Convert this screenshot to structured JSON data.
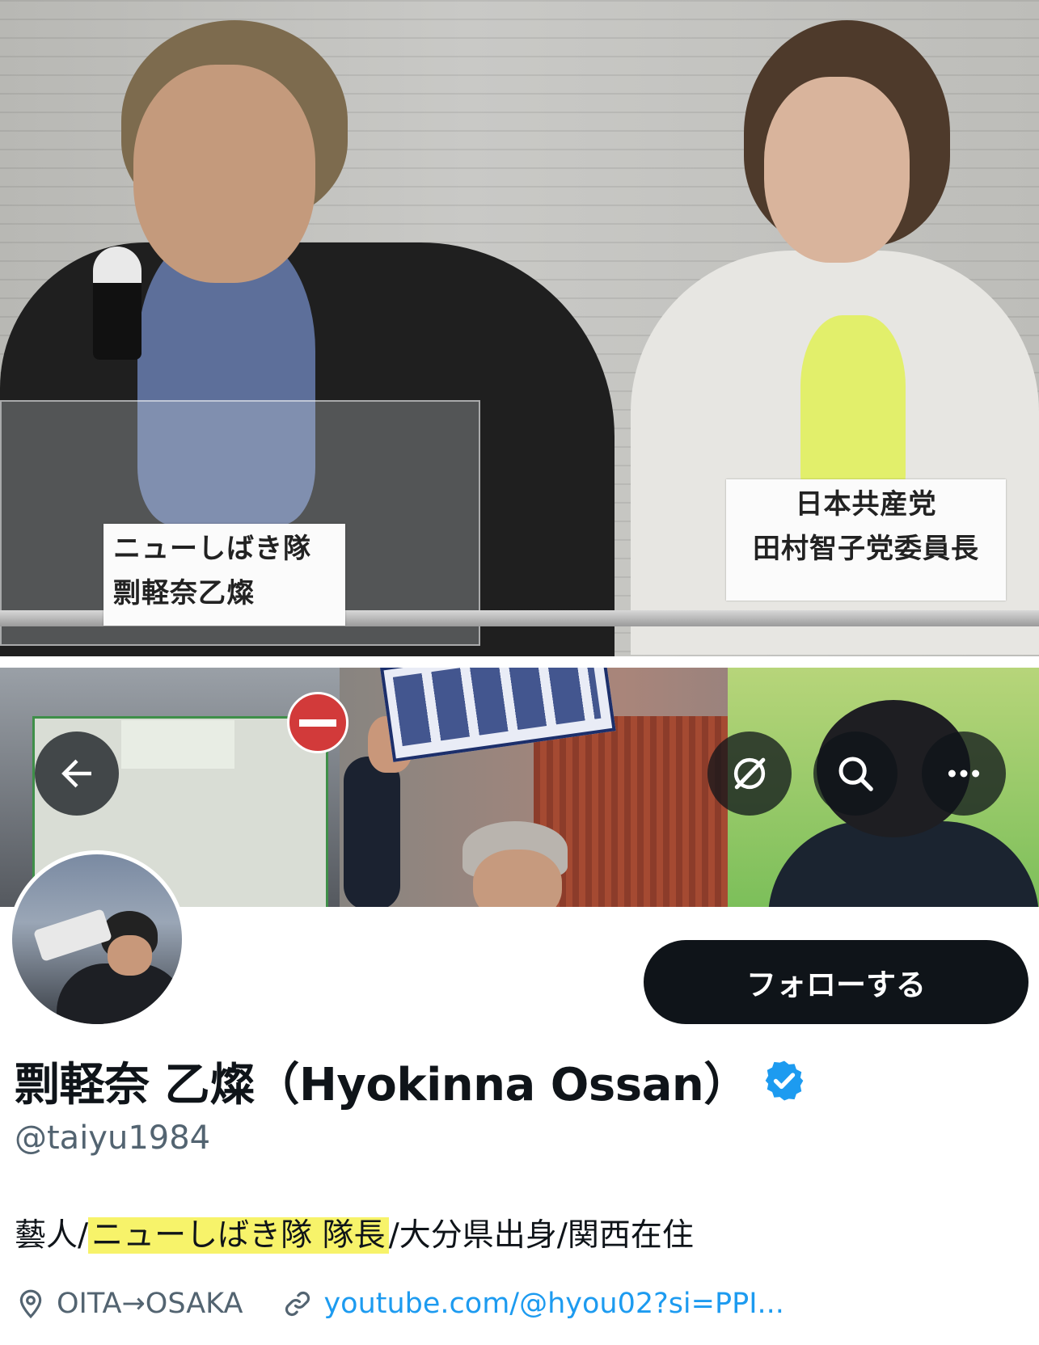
{
  "news_photo": {
    "caption_left": {
      "line1": "ニューしばき隊",
      "line2": "剽軽奈乙燦"
    },
    "caption_right": {
      "line1": "日本共産党",
      "line2": "田村智子党委員長"
    }
  },
  "banner": {
    "back_icon": "arrow-left-icon",
    "grok_icon": "grok-icon",
    "search_icon": "search-icon",
    "more_icon": "more-horizontal-icon"
  },
  "profile": {
    "follow_label": "フォローする",
    "display_name": "剽軽奈 乙燦（Hyokinna Ossan）",
    "handle": "@taiyu1984",
    "bio": {
      "part1": "藝人",
      "sep1": "/",
      "highlight": "ニューしばき隊 隊長",
      "sep2": "/",
      "part2": "大分県出身",
      "sep3": "/",
      "part3": "関西在住"
    },
    "location": "OITA→OSAKA",
    "website": "youtube.com/@hyou02?si=PPI..."
  },
  "colors": {
    "follow_bg": "#0f1419",
    "verified": "#1d9bf0",
    "link": "#1d9bf0",
    "secondary_text": "#536471",
    "highlight": "#f7f36a"
  }
}
